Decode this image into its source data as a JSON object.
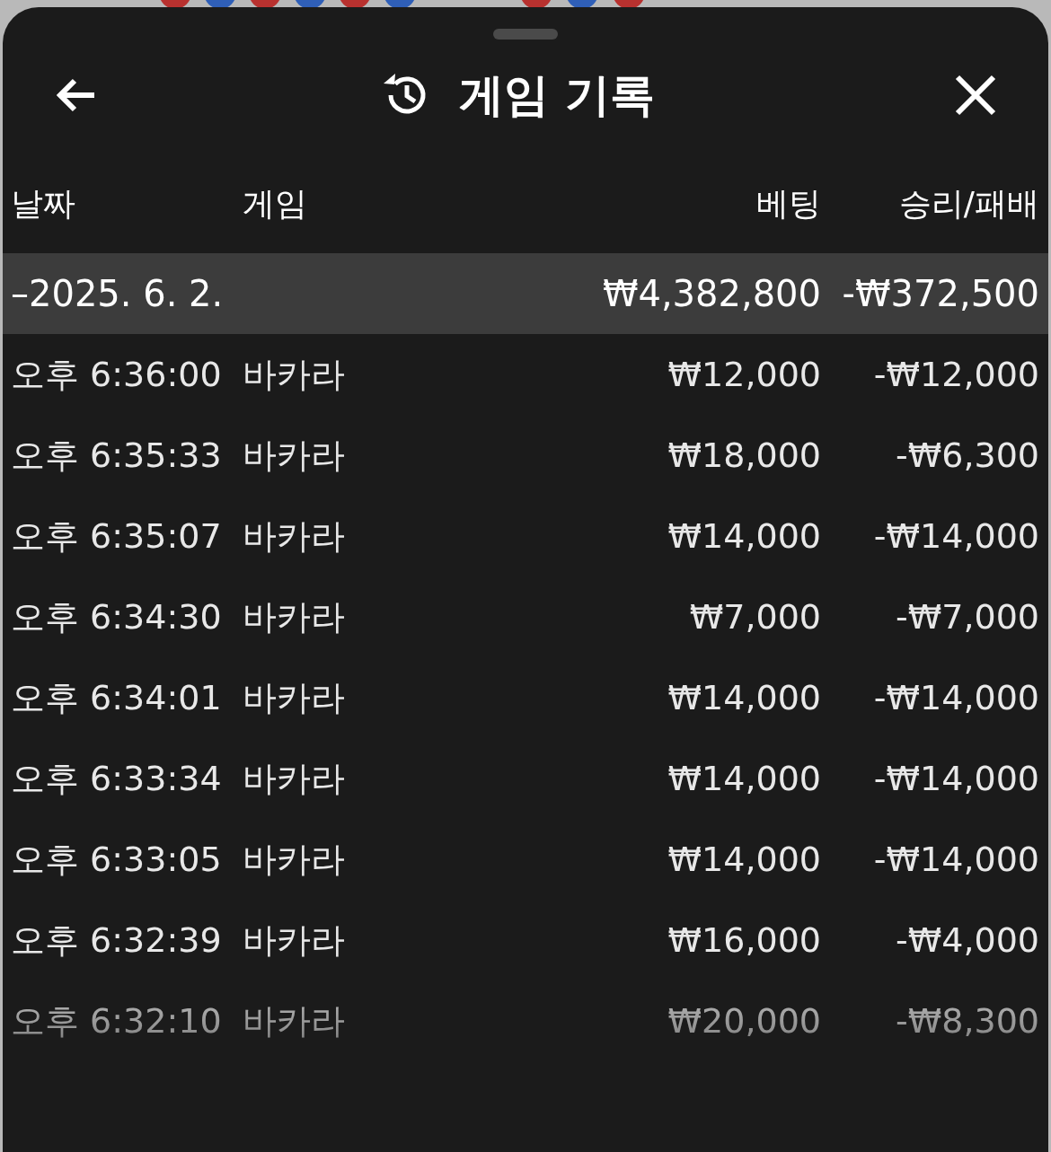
{
  "header": {
    "title": "게임 기록"
  },
  "table": {
    "columns": [
      "날짜",
      "게임",
      "베팅",
      "승리/패배"
    ],
    "summary": {
      "date": "–2025. 6. 2.",
      "bet": "₩4,382,800",
      "result": "-₩372,500"
    },
    "rows": [
      {
        "time": "오후 6:36:00",
        "game": "바카라",
        "bet": "₩12,000",
        "result": "-₩12,000"
      },
      {
        "time": "오후 6:35:33",
        "game": "바카라",
        "bet": "₩18,000",
        "result": "-₩6,300"
      },
      {
        "time": "오후 6:35:07",
        "game": "바카라",
        "bet": "₩14,000",
        "result": "-₩14,000"
      },
      {
        "time": "오후 6:34:30",
        "game": "바카라",
        "bet": "₩7,000",
        "result": "-₩7,000"
      },
      {
        "time": "오후 6:34:01",
        "game": "바카라",
        "bet": "₩14,000",
        "result": "-₩14,000"
      },
      {
        "time": "오후 6:33:34",
        "game": "바카라",
        "bet": "₩14,000",
        "result": "-₩14,000"
      },
      {
        "time": "오후 6:33:05",
        "game": "바카라",
        "bet": "₩14,000",
        "result": "-₩14,000"
      },
      {
        "time": "오후 6:32:39",
        "game": "바카라",
        "bet": "₩16,000",
        "result": "-₩4,000"
      },
      {
        "time": "오후 6:32:10",
        "game": "바카라",
        "bet": "₩20,000",
        "result": "-₩8,300"
      }
    ]
  }
}
